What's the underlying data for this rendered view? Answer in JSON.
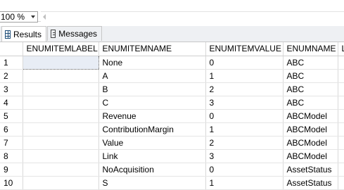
{
  "toolbar": {
    "zoom_value": "100 %"
  },
  "tabs": [
    {
      "label": "Results",
      "icon": "results-grid-icon"
    },
    {
      "label": "Messages",
      "icon": "messages-icon"
    }
  ],
  "grid": {
    "columns": [
      "",
      "ENUMITEMLABEL",
      "ENUMITEMNAME",
      "ENUMITEMVALUE",
      "ENUMNAME",
      "L"
    ],
    "rows": [
      {
        "num": "1",
        "label": "",
        "name": "None",
        "value": "0",
        "enum": "ABC"
      },
      {
        "num": "2",
        "label": "",
        "name": "A",
        "value": "1",
        "enum": "ABC"
      },
      {
        "num": "3",
        "label": "",
        "name": "B",
        "value": "2",
        "enum": "ABC"
      },
      {
        "num": "4",
        "label": "",
        "name": "C",
        "value": "3",
        "enum": "ABC"
      },
      {
        "num": "5",
        "label": "",
        "name": "Revenue",
        "value": "0",
        "enum": "ABCModel"
      },
      {
        "num": "6",
        "label": "",
        "name": "ContributionMargin",
        "value": "1",
        "enum": "ABCModel"
      },
      {
        "num": "7",
        "label": "",
        "name": "Value",
        "value": "2",
        "enum": "ABCModel"
      },
      {
        "num": "8",
        "label": "",
        "name": "Link",
        "value": "3",
        "enum": "ABCModel"
      },
      {
        "num": "9",
        "label": "",
        "name": "NoAcquisition",
        "value": "0",
        "enum": "AssetStatus"
      },
      {
        "num": "10",
        "label": "",
        "name": "S",
        "value": "1",
        "enum": "AssetStatus"
      }
    ]
  }
}
